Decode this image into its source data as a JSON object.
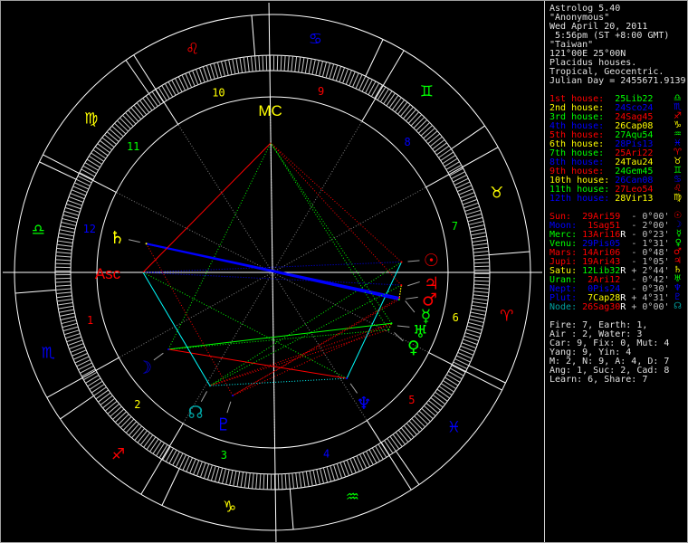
{
  "header": {
    "title": "Astrolog 5.40",
    "name": "\"Anonymous\"",
    "date": "Wed April 20, 2011",
    "time": " 5:56pm (ST +8:00 GMT)",
    "place": "\"Taiwan\"",
    "coords": "121°00E 25°00N",
    "house_system": "Placidus houses.",
    "zodiac": "Tropical, Geocentric.",
    "julian": "Julian Day = 2455671.9139"
  },
  "colors": {
    "fire": "#ff0000",
    "earth": "#ffff00",
    "air": "#00ff00",
    "water": "#0000ff",
    "node": "#00a0a0",
    "text": "#e0e0e0",
    "aspect_con": "#ffff00",
    "aspect_opp": "#0000ff",
    "aspect_sq": "#ff0000",
    "aspect_tri": "#00ff00",
    "aspect_sex": "#00ffff"
  },
  "signs": [
    {
      "name": "Aries",
      "glyph": "♈",
      "element": "fire"
    },
    {
      "name": "Taurus",
      "glyph": "♉",
      "element": "earth"
    },
    {
      "name": "Gemini",
      "glyph": "♊",
      "element": "air"
    },
    {
      "name": "Cancer",
      "glyph": "♋",
      "element": "water"
    },
    {
      "name": "Leo",
      "glyph": "♌",
      "element": "fire"
    },
    {
      "name": "Virgo",
      "glyph": "♍",
      "element": "earth"
    },
    {
      "name": "Libra",
      "glyph": "♎",
      "element": "air"
    },
    {
      "name": "Scorpio",
      "glyph": "♏",
      "element": "water"
    },
    {
      "name": "Sagittarius",
      "glyph": "♐",
      "element": "fire"
    },
    {
      "name": "Capricorn",
      "glyph": "♑",
      "element": "earth"
    },
    {
      "name": "Aquarius",
      "glyph": "♒",
      "element": "air"
    },
    {
      "name": "Pisces",
      "glyph": "♓",
      "element": "water"
    }
  ],
  "axes": {
    "asc_label": "Asc",
    "mc_label": "MC"
  },
  "houses": [
    {
      "label": "1st house:",
      "number": "1",
      "value": "25Lib22",
      "lon": 205.37,
      "sign": 6
    },
    {
      "label": "2nd house:",
      "number": "2",
      "value": "24Sco24",
      "lon": 234.4,
      "sign": 7
    },
    {
      "label": "3rd house:",
      "number": "3",
      "value": "24Sag45",
      "lon": 264.75,
      "sign": 8
    },
    {
      "label": "4th house:",
      "number": "4",
      "value": "26Cap08",
      "lon": 296.13,
      "sign": 9
    },
    {
      "label": "5th house:",
      "number": "5",
      "value": "27Aqu54",
      "lon": 327.9,
      "sign": 10
    },
    {
      "label": "6th house:",
      "number": "6",
      "value": "28Pis13",
      "lon": 358.22,
      "sign": 11
    },
    {
      "label": "7th house:",
      "number": "7",
      "value": "25Ari22",
      "lon": 25.37,
      "sign": 0
    },
    {
      "label": "8th house:",
      "number": "8",
      "value": "24Tau24",
      "lon": 54.4,
      "sign": 1
    },
    {
      "label": "9th house:",
      "number": "9",
      "value": "24Gem45",
      "lon": 84.75,
      "sign": 2
    },
    {
      "label": "10th house:",
      "number": "10",
      "value": "26Can08",
      "lon": 116.13,
      "sign": 3
    },
    {
      "label": "11th house:",
      "number": "11",
      "value": "27Leo54",
      "lon": 147.9,
      "sign": 4
    },
    {
      "label": "12th house:",
      "number": "12",
      "value": "28Vir13",
      "lon": 178.22,
      "sign": 5
    }
  ],
  "planets": [
    {
      "label": "Sun:",
      "pad": "  ",
      "value": "29Ari59",
      "retro": " ",
      "lat": "- 0°00'",
      "glyph": "☉",
      "color": "#ff0000",
      "lon": 29.98,
      "sign": 0
    },
    {
      "label": "Moon:",
      "pad": "  ",
      "value": "1Sag51",
      "retro": " ",
      "lat": "- 2°00'",
      "glyph": "☽",
      "color": "#0000ff",
      "lon": 241.85,
      "sign": 8
    },
    {
      "label": "Merc:",
      "pad": " ",
      "value": "13Ari16",
      "retro": "R",
      "lat": "- 0°23'",
      "glyph": "☿",
      "color": "#00ff00",
      "lon": 13.27,
      "sign": 0
    },
    {
      "label": "Venu:",
      "pad": " ",
      "value": "29Pis05",
      "retro": " ",
      "lat": "- 1°31'",
      "glyph": "♀",
      "color": "#00ff00",
      "lon": 359.08,
      "sign": 11
    },
    {
      "label": "Mars:",
      "pad": " ",
      "value": "14Ari06",
      "retro": " ",
      "lat": "- 0°48'",
      "glyph": "♂",
      "color": "#ff0000",
      "lon": 14.1,
      "sign": 0
    },
    {
      "label": "Jupi:",
      "pad": " ",
      "value": "19Ari43",
      "retro": " ",
      "lat": "- 1°05'",
      "glyph": "♃",
      "color": "#ff0000",
      "lon": 19.72,
      "sign": 0
    },
    {
      "label": "Satu:",
      "pad": " ",
      "value": "12Lib32",
      "retro": "R",
      "lat": "+ 2°44'",
      "glyph": "♄",
      "color": "#ffff00",
      "lon": 192.53,
      "sign": 6
    },
    {
      "label": "Uran:",
      "pad": "  ",
      "value": "2Ari12",
      "retro": " ",
      "lat": "- 0°42'",
      "glyph": "♅",
      "color": "#00ff00",
      "lon": 2.2,
      "sign": 0
    },
    {
      "label": "Nept:",
      "pad": "  ",
      "value": "0Pis24",
      "retro": " ",
      "lat": "- 0°30'",
      "glyph": "♆",
      "color": "#0000ff",
      "lon": 330.4,
      "sign": 11
    },
    {
      "label": "Plut:",
      "pad": "  ",
      "value": "7Cap28",
      "retro": "R",
      "lat": "+ 4°31'",
      "glyph": "♇",
      "color": "#0000ff",
      "lon": 277.47,
      "sign": 9
    },
    {
      "label": "Node:",
      "pad": " ",
      "value": "26Sag30",
      "retro": "R",
      "lat": "+ 0°00'",
      "glyph": "☊",
      "color": "#00a0a0",
      "lon": 266.5,
      "sign": 8
    }
  ],
  "summary": [
    "Fire: 7, Earth: 1,",
    "Air : 2, Water: 3",
    "Car: 9, Fix: 0, Mut: 4",
    "Yang: 9, Yin: 4",
    "M: 2, N: 9, A: 4, D: 7",
    "Ang: 1, Suc: 2, Cad: 8",
    "Learn: 6, Share: 7"
  ]
}
